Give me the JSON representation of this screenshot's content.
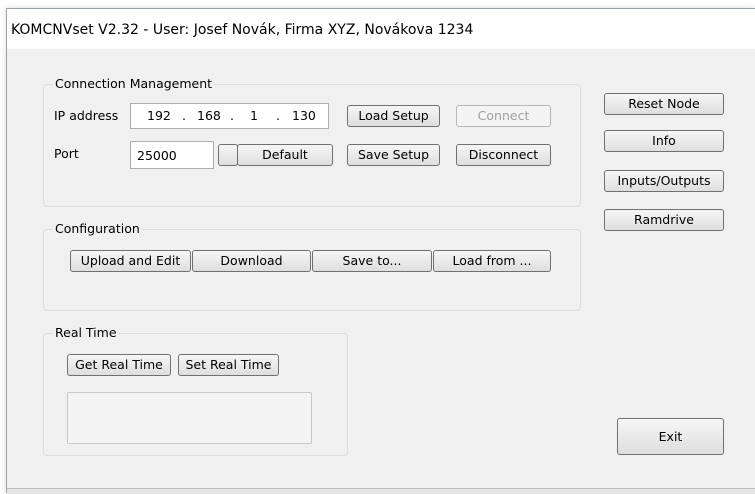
{
  "window": {
    "title": "KOMCNVset V2.32 - User: Josef Novák, Firma XYZ, Novákova 1234"
  },
  "connection": {
    "group_label": "Connection Management",
    "ip_label": "IP address",
    "ip": {
      "o1": "192",
      "o2": "168",
      "o3": "1",
      "o4": "130",
      "dot": "."
    },
    "port_label": "Port",
    "port_value": "25000",
    "default_label": "Default",
    "load_setup_label": "Load Setup",
    "save_setup_label": "Save Setup",
    "connect_label": "Connect",
    "disconnect_label": "Disconnect"
  },
  "configuration": {
    "group_label": "Configuration",
    "upload_label": "Upload and Edit",
    "download_label": "Download",
    "save_to_label": "Save to...",
    "load_from_label": "Load from ..."
  },
  "realtime": {
    "group_label": "Real Time",
    "get_label": "Get Real Time",
    "set_label": "Set Real Time",
    "display_value": ""
  },
  "side": {
    "reset_node_label": "Reset Node",
    "info_label": "Info",
    "io_label": "Inputs/Outputs",
    "ramdrive_label": "Ramdrive"
  },
  "exit_label": "Exit",
  "states": {
    "connect_enabled": false
  }
}
